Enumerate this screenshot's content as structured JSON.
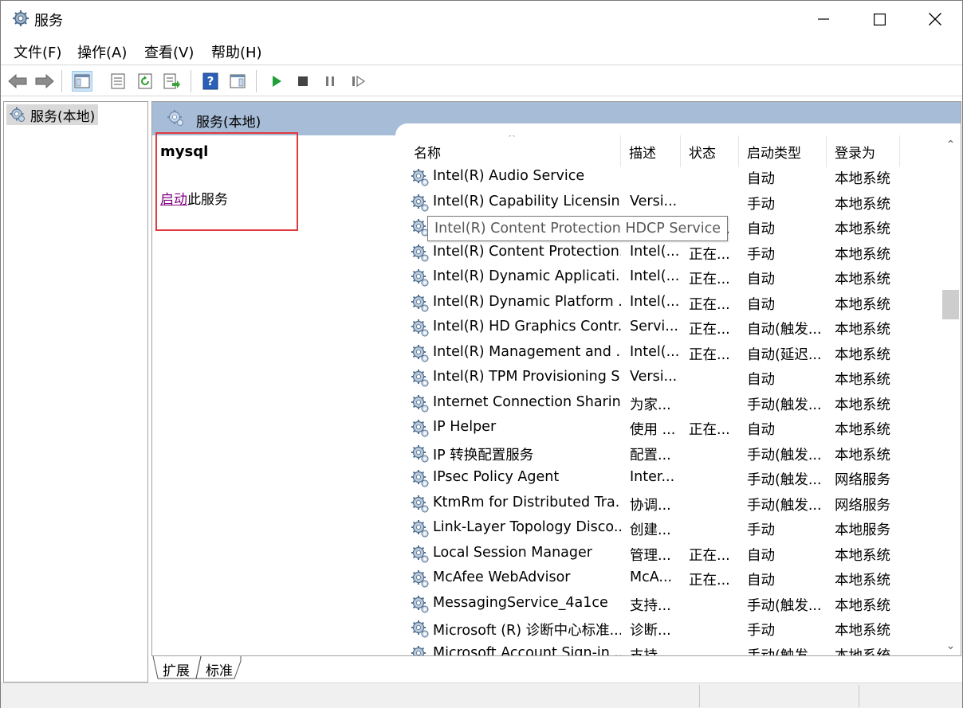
{
  "window": {
    "title": "服务",
    "icon": "gear-icon"
  },
  "menu": [
    {
      "label": "文件(F)"
    },
    {
      "label": "操作(A)"
    },
    {
      "label": "查看(V)"
    },
    {
      "label": "帮助(H)"
    }
  ],
  "toolbar": {
    "icons": [
      "back-icon",
      "forward-icon",
      "show-hide-console-tree-icon",
      "properties-icon",
      "refresh-icon",
      "export-list-icon",
      "help-icon",
      "show-hide-action-pane-icon",
      "start-service-icon",
      "stop-service-icon",
      "pause-service-icon",
      "restart-service-icon"
    ]
  },
  "tree": {
    "item_label": "服务(本地)"
  },
  "pane": {
    "header_title": "服务(本地)",
    "selected_service": "mysql",
    "action_link": "启动",
    "action_suffix": "此服务"
  },
  "columns": {
    "name": "名称",
    "desc": "描述",
    "status": "状态",
    "startup": "启动类型",
    "logon": "登录为"
  },
  "tooltip": "Intel(R) Content Protection HDCP Service",
  "services": [
    {
      "name": "Intel(R) Audio Service",
      "desc": "",
      "status": "",
      "startup": "自动",
      "logon": "本地系统"
    },
    {
      "name": "Intel(R) Capability Licensin...",
      "desc": "Versi...",
      "status": "",
      "startup": "手动",
      "logon": "本地系统"
    },
    {
      "name": "Intel(R) Content Protection...",
      "desc": "",
      "status": "正在...",
      "startup": "自动",
      "logon": "本地系统"
    },
    {
      "name": "Intel(R) Content Protection...",
      "desc": "Intel(...",
      "status": "正在...",
      "startup": "手动",
      "logon": "本地系统"
    },
    {
      "name": "Intel(R) Dynamic Applicati...",
      "desc": "Intel(...",
      "status": "正在...",
      "startup": "自动",
      "logon": "本地系统"
    },
    {
      "name": "Intel(R) Dynamic Platform ...",
      "desc": "Intel(...",
      "status": "正在...",
      "startup": "自动",
      "logon": "本地系统"
    },
    {
      "name": "Intel(R) HD Graphics Contr...",
      "desc": "Servi...",
      "status": "正在...",
      "startup": "自动(触发...",
      "logon": "本地系统"
    },
    {
      "name": "Intel(R) Management and ...",
      "desc": "Intel(...",
      "status": "正在...",
      "startup": "自动(延迟...",
      "logon": "本地系统"
    },
    {
      "name": "Intel(R) TPM Provisioning S...",
      "desc": "Versi...",
      "status": "",
      "startup": "自动",
      "logon": "本地系统"
    },
    {
      "name": "Internet Connection Sharin...",
      "desc": "为家...",
      "status": "",
      "startup": "手动(触发...",
      "logon": "本地系统"
    },
    {
      "name": "IP Helper",
      "desc": "使用 ...",
      "status": "正在...",
      "startup": "自动",
      "logon": "本地系统"
    },
    {
      "name": "IP 转换配置服务",
      "desc": "配置...",
      "status": "",
      "startup": "手动(触发...",
      "logon": "本地系统"
    },
    {
      "name": "IPsec Policy Agent",
      "desc": "Inter...",
      "status": "",
      "startup": "手动(触发...",
      "logon": "网络服务"
    },
    {
      "name": "KtmRm for Distributed Tra...",
      "desc": "协调...",
      "status": "",
      "startup": "手动(触发...",
      "logon": "网络服务"
    },
    {
      "name": "Link-Layer Topology Disco...",
      "desc": "创建...",
      "status": "",
      "startup": "手动",
      "logon": "本地服务"
    },
    {
      "name": "Local Session Manager",
      "desc": "管理...",
      "status": "正在...",
      "startup": "自动",
      "logon": "本地系统"
    },
    {
      "name": "McAfee WebAdvisor",
      "desc": "McA...",
      "status": "正在...",
      "startup": "自动",
      "logon": "本地系统"
    },
    {
      "name": "MessagingService_4a1ce",
      "desc": "支持...",
      "status": "",
      "startup": "手动(触发...",
      "logon": "本地系统"
    },
    {
      "name": "Microsoft (R) 诊断中心标准...",
      "desc": "诊断...",
      "status": "",
      "startup": "手动",
      "logon": "本地系统"
    },
    {
      "name": "Microsoft Account Sign-in ...",
      "desc": "支持...",
      "status": "",
      "startup": "手动(触发...",
      "logon": "本地系统"
    }
  ],
  "tabs": [
    {
      "label": "扩展"
    },
    {
      "label": "标准"
    }
  ]
}
